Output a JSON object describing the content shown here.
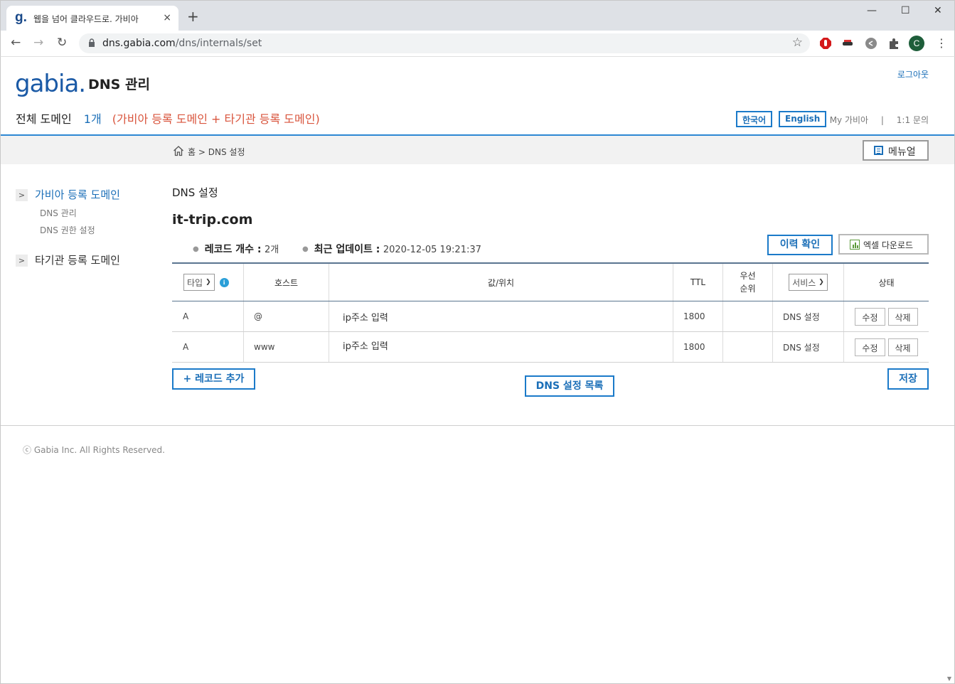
{
  "browser": {
    "tab_favicon": "g.",
    "tab_title": "웹을 넘어 클라우드로. 가비아",
    "tab_close": "×",
    "new_tab": "+",
    "url_host": "dns.gabia.com",
    "url_path": "/dns/internals/set",
    "profile_initial": "C",
    "win_min": "—",
    "win_max": "☐",
    "win_close": "✕"
  },
  "header": {
    "logo": "gabia.",
    "service_title": "DNS 관리",
    "logout": "로그아웃",
    "domain_label": "전체 도메인",
    "domain_count": "1개",
    "domain_note": "(가비아 등록 도메인 + 타기관 등록 도메인)",
    "lang_ko": "한국어",
    "lang_en": "English",
    "my_gabia": "My 가비아",
    "separator": "|",
    "inquiry": "1:1 문의"
  },
  "breadcrumb": {
    "home": "홈",
    "sep": ">",
    "current": "DNS 설정",
    "manual": "메뉴얼"
  },
  "sidebar": {
    "groups": [
      {
        "label": "가비아 등록 도메인",
        "items": [
          "DNS 관리",
          "DNS 권한 설정"
        ]
      },
      {
        "label": "타기관 등록 도메인",
        "items": []
      }
    ]
  },
  "main": {
    "section_title": "DNS 설정",
    "domain": "it-trip.com",
    "record_count_label": "레코드 개수 :",
    "record_count": "2개",
    "updated_label": "최근 업데이트 :",
    "updated": "2020-12-05 19:21:37",
    "history_button": "이력 확인",
    "excel_button": "엑셀 다운로드",
    "add_button": "+ 레코드 추가",
    "list_button": "DNS 설정 목록",
    "save_button": "저장"
  },
  "table": {
    "headers": {
      "type": "타입",
      "host": "호스트",
      "value": "값/위치",
      "ttl": "TTL",
      "priority_1": "우선",
      "priority_2": "순위",
      "service": "서비스",
      "status": "상태"
    },
    "rows": [
      {
        "type": "A",
        "host": "@",
        "value": "ip주소 입력",
        "ttl": "1800",
        "priority": "",
        "service": "DNS 설정",
        "edit": "수정",
        "delete": "삭제"
      },
      {
        "type": "A",
        "host": "www",
        "value": "ip주소 입력",
        "ttl": "1800",
        "priority": "",
        "service": "DNS 설정",
        "edit": "수정",
        "delete": "삭제"
      }
    ]
  },
  "footer": {
    "copyright": "ⓒ Gabia Inc. All Rights Reserved."
  },
  "colors": {
    "accent": "#1b6fb8",
    "note": "#d9553d",
    "rule": "#2d87d3"
  }
}
